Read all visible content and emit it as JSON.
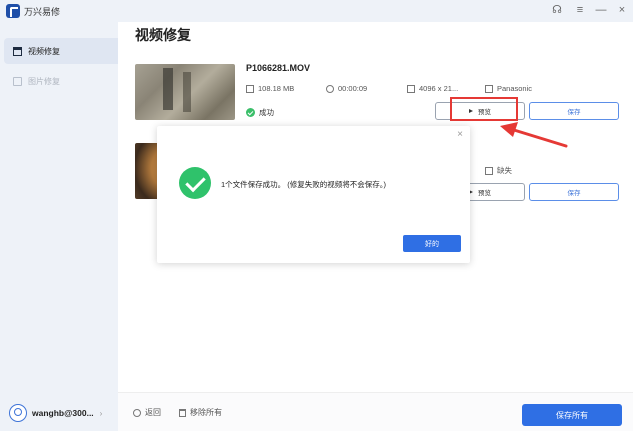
{
  "app": {
    "title": "万兴易修"
  },
  "window_controls": {
    "headset": "☊",
    "menu": "≡",
    "minimize": "—",
    "close": "×"
  },
  "sidebar": {
    "items": [
      {
        "label": "视频修复",
        "icon": "video-repair-icon",
        "active": true
      },
      {
        "label": "图片修复",
        "icon": "image-repair-icon",
        "active": false
      }
    ],
    "user": {
      "name": "wanghb@300...",
      "chevron": "›"
    }
  },
  "main": {
    "title": "视频修复",
    "files": [
      {
        "name": "P1066281.MOV",
        "size": "108.18 MB",
        "duration": "00:00:09",
        "resolution": "4096 x 21...",
        "camera": "Panasonic",
        "status": "成功",
        "preview_label": "预览",
        "save_label": "保存"
      },
      {
        "camera": "缺失",
        "preview_label": "预览",
        "save_label": "保存"
      }
    ]
  },
  "bottom_bar": {
    "back_label": "返回",
    "remove_all_label": "移除所有",
    "save_all_label": "保存所有"
  },
  "dialog": {
    "close": "×",
    "message": "1个文件保存成功。 (修复失败的视频将不会保存。)",
    "ok_label": "好的"
  },
  "colors": {
    "accent": "#2f6fe4",
    "success": "#2fc26b",
    "annotation": "#e53935"
  }
}
